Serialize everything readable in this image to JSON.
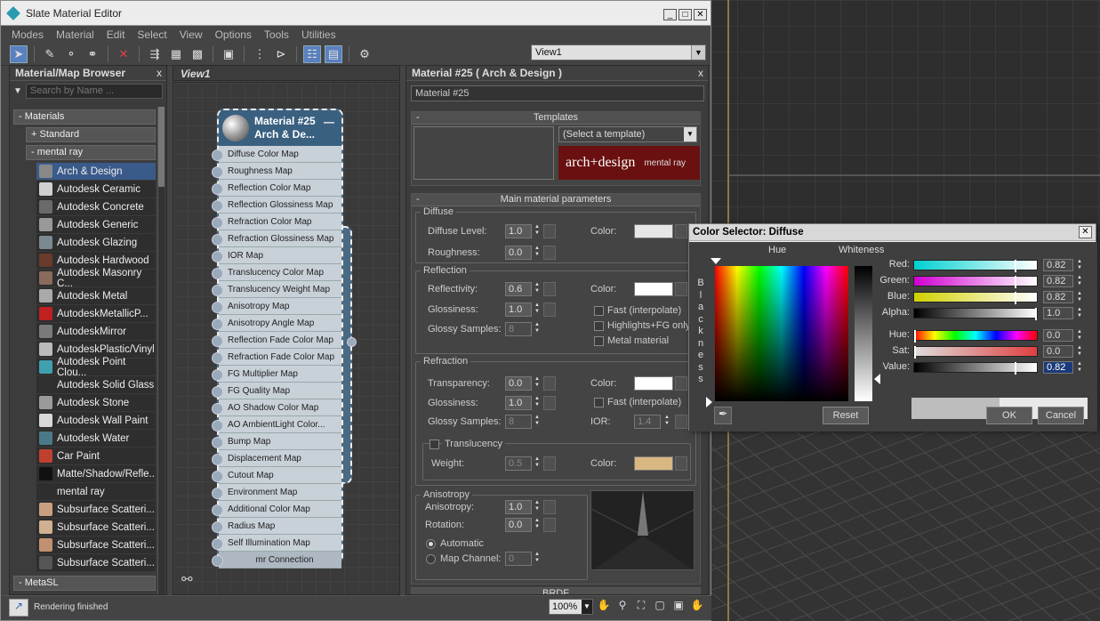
{
  "window": {
    "title": "Slate Material Editor"
  },
  "menu": [
    "Modes",
    "Material",
    "Edit",
    "Select",
    "View",
    "Options",
    "Tools",
    "Utilities"
  ],
  "view_select": "View1",
  "browser": {
    "title": "Material/Map Browser",
    "close": "x",
    "search_placeholder": "Search by Name ...",
    "group_materials": "- Materials",
    "group_standard": "+ Standard",
    "group_mentalray": "- mental ray",
    "group_metasl": "- MetaSL",
    "items": [
      {
        "label": "Arch & Design",
        "swatch": "#888888"
      },
      {
        "label": "Autodesk Ceramic",
        "swatch": "#d0d0d0"
      },
      {
        "label": "Autodesk Concrete",
        "swatch": "#6a6a6a"
      },
      {
        "label": "Autodesk Generic",
        "swatch": "#999999"
      },
      {
        "label": "Autodesk Glazing",
        "swatch": "#7a8a90"
      },
      {
        "label": "Autodesk Hardwood",
        "swatch": "#6a3a2a"
      },
      {
        "label": "Autodesk Masonry C...",
        "swatch": "#8a6a5a"
      },
      {
        "label": "Autodesk Metal",
        "swatch": "#aaaaaa"
      },
      {
        "label": "AutodeskMetallicP...",
        "swatch": "#c02020"
      },
      {
        "label": "AutodeskMirror",
        "swatch": "#7a7a7a"
      },
      {
        "label": "AutodeskPlastic/Vinyl",
        "swatch": "#bbbbbb"
      },
      {
        "label": "Autodesk Point Clou...",
        "swatch": "#40a0b0"
      },
      {
        "label": "Autodesk Solid Glass",
        "swatch": "#303030"
      },
      {
        "label": "Autodesk Stone",
        "swatch": "#9a9a9a"
      },
      {
        "label": "Autodesk Wall Paint",
        "swatch": "#d8d8d8"
      },
      {
        "label": "Autodesk Water",
        "swatch": "#4a7a8a"
      },
      {
        "label": "Car Paint",
        "swatch": "#c04030"
      },
      {
        "label": "Matte/Shadow/Refle...",
        "swatch": "#111111"
      },
      {
        "label": "mental ray",
        "swatch": "#2e2e2e"
      },
      {
        "label": "Subsurface Scatteri...",
        "swatch": "#c8a080"
      },
      {
        "label": "Subsurface Scatteri...",
        "swatch": "#d0b090"
      },
      {
        "label": "Subsurface Scatteri...",
        "swatch": "#c09070"
      },
      {
        "label": "Subsurface Scatteri...",
        "swatch": "#555555"
      }
    ]
  },
  "view1": {
    "tab": "View1"
  },
  "node": {
    "title_line1": "Material #25",
    "title_line2": "Arch & De...",
    "minimize": "—",
    "slots": [
      "Diffuse Color Map",
      "Roughness Map",
      "Reflection Color Map",
      "Reflection Glossiness Map",
      "Refraction Color Map",
      "Refraction Glossiness Map",
      "IOR Map",
      "Translucency Color Map",
      "Translucency Weight Map",
      "Anisotropy Map",
      "Anisotropy Angle Map",
      "Reflection Fade Color Map",
      "Refraction Fade Color Map",
      "FG Multiplier Map",
      "FG Quality Map",
      "AO Shadow Color Map",
      "AO AmbientLight Color...",
      "Bump Map",
      "Displacement Map",
      "Cutout Map",
      "Environment Map",
      "Additional Color Map",
      "Radius Map",
      "Self Illumination Map"
    ],
    "connection": "mr Connection"
  },
  "props": {
    "title": "Material #25  ( Arch & Design )",
    "close": "x",
    "name": "Material #25",
    "templates": {
      "header": "Templates",
      "select": "(Select a template)",
      "logo_main": "arch+design",
      "logo_sub": "mental ray"
    },
    "main_header": "Main material parameters",
    "diffuse": {
      "group": "Diffuse",
      "level_label": "Diffuse Level:",
      "level": "1.0",
      "rough_label": "Roughness:",
      "rough": "0.0",
      "color_label": "Color:",
      "color": "#e6e6e6"
    },
    "reflection": {
      "group": "Reflection",
      "refl_label": "Reflectivity:",
      "refl": "0.6",
      "gloss_label": "Glossiness:",
      "gloss": "1.0",
      "samples_label": "Glossy Samples:",
      "samples": "8",
      "color_label": "Color:",
      "color": "#ffffff",
      "fast": "Fast (interpolate)",
      "highlights": "Highlights+FG only",
      "metal": "Metal material"
    },
    "refraction": {
      "group": "Refraction",
      "trans_label": "Transparency:",
      "trans": "0.0",
      "gloss_label": "Glossiness:",
      "gloss": "1.0",
      "samples_label": "Glossy Samples:",
      "samples": "8",
      "color_label": "Color:",
      "color": "#ffffff",
      "fast": "Fast (interpolate)",
      "ior_label": "IOR:",
      "ior": "1.4"
    },
    "translucency": {
      "label": "Translucency",
      "weight_label": "Weight:",
      "weight": "0.5",
      "color_label": "Color:",
      "color": "#d8b880"
    },
    "anisotropy": {
      "group": "Anisotropy",
      "aniso_label": "Anisotropy:",
      "aniso": "1.0",
      "rot_label": "Rotation:",
      "rot": "0.0",
      "automatic": "Automatic",
      "mapch_label": "Map Channel:",
      "mapch": "0"
    },
    "brdf": "BRDF"
  },
  "status": {
    "text": "Rendering finished",
    "zoom": "100%"
  },
  "color_selector": {
    "title": "Color Selector: Diffuse",
    "close": "x",
    "hue_label": "Hue",
    "whiteness_label": "Whiteness",
    "blackness_letters": [
      "B",
      "l",
      "a",
      "c",
      "k",
      "n",
      "e",
      "s",
      "s"
    ],
    "channels": [
      {
        "label": "Red:",
        "value": "0.82"
      },
      {
        "label": "Green:",
        "value": "0.82"
      },
      {
        "label": "Blue:",
        "value": "0.82"
      },
      {
        "label": "Alpha:",
        "value": "1.0"
      },
      {
        "label": "Hue:",
        "value": "0.0"
      },
      {
        "label": "Sat:",
        "value": "0.0"
      },
      {
        "label": "Value:",
        "value": "0.82"
      }
    ],
    "reset": "Reset",
    "ok": "OK",
    "cancel": "Cancel",
    "old_color": "#bdbdbd",
    "new_color": "#e8e8e8"
  }
}
